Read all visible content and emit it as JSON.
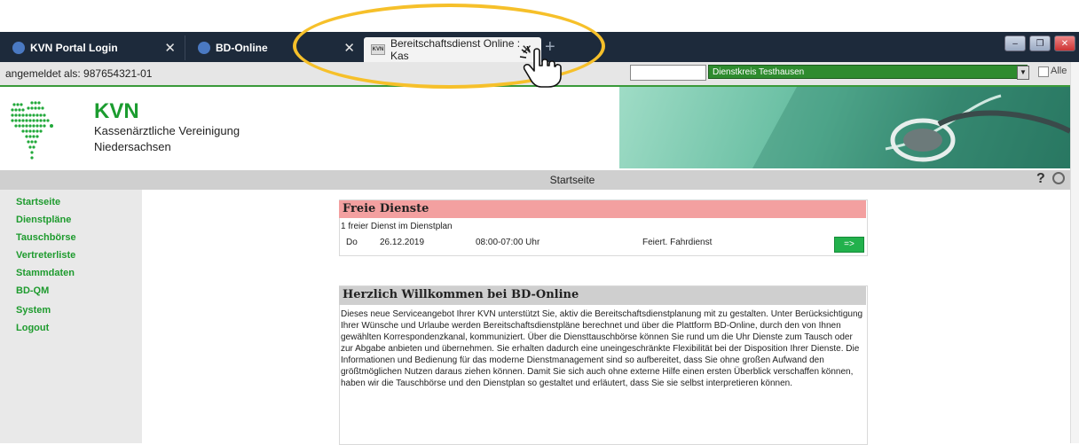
{
  "browser": {
    "tabs": [
      {
        "label": "KVN Portal Login"
      },
      {
        "label": "BD-Online"
      },
      {
        "label": "Bereitschaftsdienst Online : Kas",
        "favicon": "KVN"
      }
    ],
    "new_tab_symbol": "+",
    "close_symbol": "✕"
  },
  "window_controls": {
    "minimize": "–",
    "restore": "❐",
    "close": "✕"
  },
  "topbar": {
    "login_text": "angemeldet als: 987654321-01",
    "search_value": "",
    "dienstkreis": "Dienstkreis Testhausen",
    "alle_label": "Alle"
  },
  "header": {
    "brand": "KVN",
    "org_line1": "Kassenärztliche Vereinigung",
    "org_line2": "Niedersachsen",
    "accent_color": "#1b9c2f"
  },
  "page": {
    "title": "Startseite",
    "help_symbol": "?"
  },
  "sidebar": {
    "items": [
      {
        "label": "Startseite"
      },
      {
        "label": "Dienstpläne"
      },
      {
        "label": "Tauschbörse"
      },
      {
        "label": "Vertreterliste"
      },
      {
        "label": "Stammdaten"
      },
      {
        "label": "BD-QM"
      },
      {
        "label": "System"
      },
      {
        "label": "Logout"
      }
    ]
  },
  "free_services": {
    "title": "Freie Dienste",
    "subtitle": "1 freier Dienst im Dienstplan",
    "row": {
      "day": "Do",
      "date": "26.12.2019",
      "time": "08:00-07:00 Uhr",
      "type": "Feiert. Fahrdienst",
      "button": "=>"
    }
  },
  "welcome": {
    "title": "Herzlich Willkommen bei BD-Online",
    "body": "Dieses neue Serviceangebot Ihrer KVN unterstützt Sie, aktiv die Bereitschaftsdienstplanung mit zu gestalten. Unter Berücksichtigung Ihrer Wünsche und Urlaube werden Bereitschaftsdienstpläne berechnet und über die Plattform BD-Online, durch den von Ihnen gewählten Korrespondenzkanal, kommuniziert. Über die Diensttauschbörse können Sie rund um die Uhr Dienste zum Tausch oder zur Abgabe anbieten und übernehmen. Sie erhalten dadurch eine uneingeschränkte Flexibilität bei der Disposition Ihrer Dienste. Die Informationen und Bedienung für das moderne Dienstmanagement sind so aufbereitet, dass Sie ohne großen Aufwand den größtmöglichen Nutzen daraus ziehen können. Damit Sie sich auch ohne externe Hilfe einen ersten Überblick verschaffen können, haben wir die Tauschbörse und den Dienstplan so gestaltet und erläutert, dass Sie sie selbst interpretieren können."
  },
  "annotation": {
    "ring_color": "#f6c02a",
    "cursor_icon": "hand-pointer-icon"
  }
}
